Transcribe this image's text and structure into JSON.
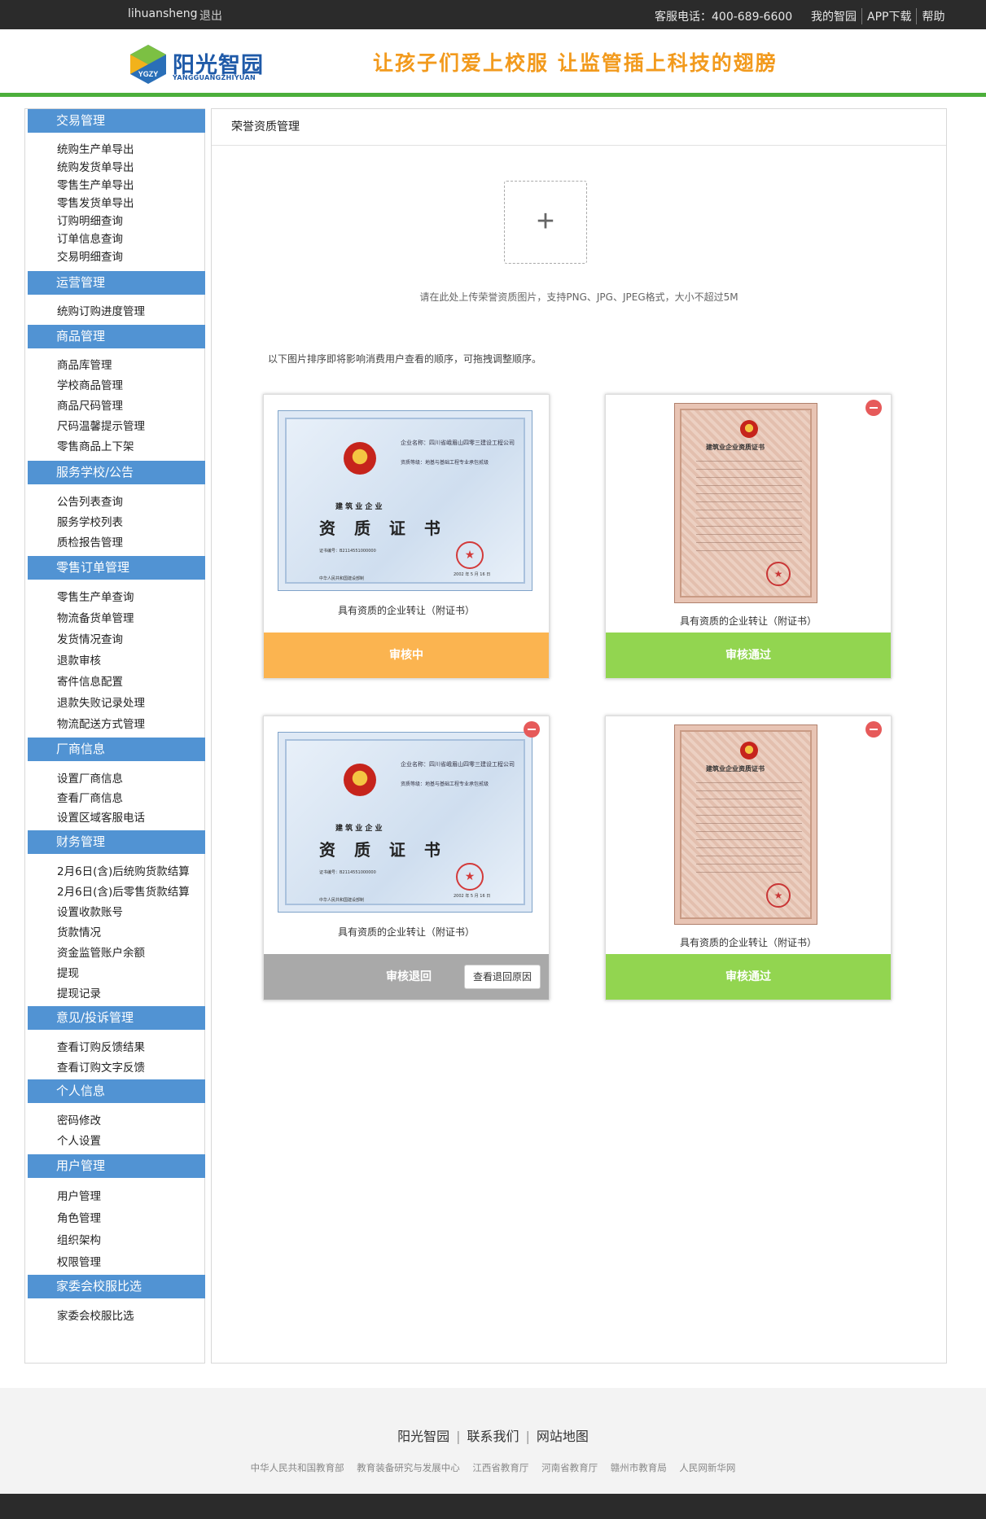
{
  "topbar": {
    "username": "lihuansheng",
    "logout": "退出",
    "hotline": "客服电话：400-689-6600",
    "links": [
      "我的智园",
      "APP下载",
      "帮助"
    ]
  },
  "header": {
    "logo_text": "阳光智园",
    "logo_sub": "YANGGUANGZHIYUAN",
    "logo_badge": "YGZY",
    "slogan": "让孩子们爱上校服  让监管插上科技的翅膀"
  },
  "sidebar": {
    "sections": [
      {
        "title": "交易管理",
        "items": [
          "统购生产单导出",
          "统购发货单导出",
          "零售生产单导出",
          "零售发货单导出",
          "订购明细查询",
          "订单信息查询",
          "交易明细查询"
        ]
      },
      {
        "title": "运营管理",
        "items": [
          "统购订购进度管理"
        ]
      },
      {
        "title": "商品管理",
        "items": [
          "商品库管理",
          "学校商品管理",
          "商品尺码管理",
          "尺码温馨提示管理",
          "零售商品上下架"
        ]
      },
      {
        "title": "服务学校/公告",
        "items": [
          "公告列表查询",
          "服务学校列表",
          "质检报告管理"
        ]
      },
      {
        "title": "零售订单管理",
        "items": [
          "零售生产单查询",
          "物流备货单管理",
          "发货情况查询",
          "退款审核",
          "寄件信息配置",
          "退款失败记录处理",
          "物流配送方式管理"
        ]
      },
      {
        "title": "厂商信息",
        "items": [
          "设置厂商信息",
          "查看厂商信息",
          "设置区域客服电话"
        ]
      },
      {
        "title": "财务管理",
        "items": [
          "2月6日(含)后统购货款结算",
          "2月6日(含)后零售货款结算",
          "设置收款账号",
          "货款情况",
          "资金监管账户余额",
          "提现",
          "提现记录"
        ]
      },
      {
        "title": "意见/投诉管理",
        "items": [
          "查看订购反馈结果",
          "查看订购文字反馈"
        ]
      },
      {
        "title": "个人信息",
        "items": [
          "密码修改",
          "个人设置"
        ]
      },
      {
        "title": "用户管理",
        "items": [
          "用户管理",
          "角色管理",
          "组织架构",
          "权限管理"
        ]
      },
      {
        "title": "家委会校服比选",
        "items": [
          "家委会校服比选"
        ]
      }
    ]
  },
  "main": {
    "title": "荣誉资质管理",
    "upload_plus": "+",
    "upload_hint": "请在此处上传荣誉资质图片，支持PNG、JPG、JPEG格式，大小不超过5M",
    "order_hint": "以下图片排序即将影响消费用户查看的顺序，可拖拽调整顺序。",
    "cards": [
      {
        "caption": "具有资质的企业转让（附证书）",
        "status": "审核中",
        "cert": "blue",
        "deletable": false
      },
      {
        "caption": "具有资质的企业转让（附证书）",
        "status": "审核通过",
        "cert": "red",
        "deletable": true
      },
      {
        "caption": "具有资质的企业转让（附证书）",
        "status": "审核退回",
        "cert": "blue",
        "deletable": true,
        "reason_button": "查看退回原因"
      },
      {
        "caption": "具有资质的企业转让（附证书）",
        "status": "审核通过",
        "cert": "red",
        "deletable": true
      }
    ],
    "cert_blue": {
      "company": "企业名称：四川省峨眉山四零三建设工程公司",
      "scope": "资质等级：地基与基础工程专业承包贰级",
      "subtitle": "建 筑 业 企 业",
      "heading": "资 质 证 书",
      "number": "证书编号：B2114551000000",
      "issuer": "发证机关：",
      "footer": "中华人民共和国建设部制",
      "date": "2002 年 5 月 16 日"
    },
    "cert_red": {
      "title": "建筑业企业资质证书"
    }
  },
  "footer": {
    "links": [
      "阳光智园",
      "联系我们",
      "网站地图"
    ],
    "orgs": [
      "中华人民共和国教育部",
      "教育装备研究与发展中心",
      "江西省教育厅",
      "河南省教育厅",
      "赣州市教育局",
      "人民网新华网"
    ]
  },
  "colors": {
    "topbar": "#2b2b2b",
    "accent_green": "#4caf3b",
    "sidebar_header": "#5193d3",
    "status_pending": "#fbb450",
    "status_pass": "#92d550",
    "status_reject": "#a9a9a9",
    "delete": "#e65a5a",
    "slogan": "#f29a1d"
  }
}
